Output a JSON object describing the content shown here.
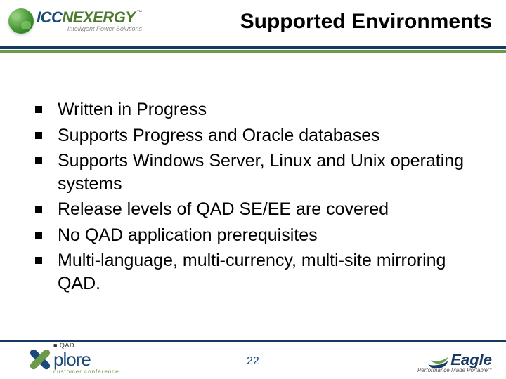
{
  "header": {
    "logo_icc": {
      "main_icc": "ICC",
      "main_nexergy": "NEXERGY",
      "tm": "™",
      "tagline": "Intelligent Power Solutions"
    },
    "title": "Supported Environments"
  },
  "bullets": [
    "Written in Progress",
    "Supports Progress and Oracle databases",
    "Supports Windows Server, Linux and Unix operating systems",
    "Release levels of QAD SE/EE are covered",
    "No QAD application prerequisites",
    "Multi-language, multi-currency, multi-site mirroring QAD."
  ],
  "footer": {
    "explore": {
      "qad": "■ QAD",
      "word": "plore",
      "sub": "customer conference"
    },
    "page": "22",
    "eagle": {
      "word": "Eagle",
      "sub": "Performance Made Portable",
      "tm": "™"
    }
  }
}
